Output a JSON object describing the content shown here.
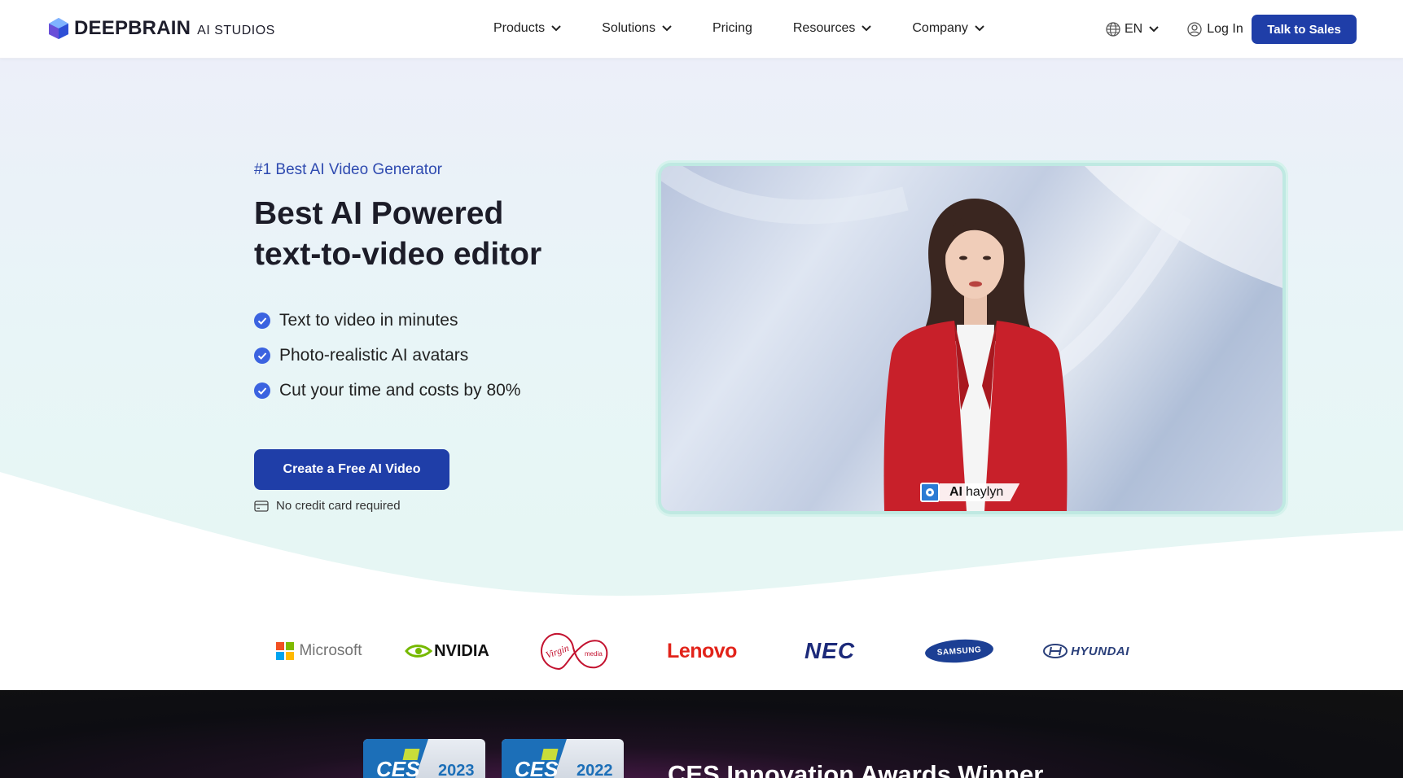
{
  "header": {
    "logo": {
      "brand": "DEEPBRAIN",
      "product": "AI STUDIOS",
      "icon": "deepbrain-cube-logo"
    },
    "nav": [
      {
        "label": "Products",
        "has_dropdown": true
      },
      {
        "label": "Solutions",
        "has_dropdown": true
      },
      {
        "label": "Pricing",
        "has_dropdown": false
      },
      {
        "label": "Resources",
        "has_dropdown": true
      },
      {
        "label": "Company",
        "has_dropdown": true
      }
    ],
    "language": {
      "label": "EN",
      "icon": "globe-icon"
    },
    "login": {
      "label": "Log In",
      "icon": "user-circle-icon"
    },
    "sales_button": "Talk to Sales"
  },
  "hero": {
    "tagline": "#1 Best AI Video Generator",
    "title_line1": "Best AI Powered",
    "title_line2": "text-to-video editor",
    "features": [
      "Text to video in minutes",
      "Photo-realistic AI avatars",
      "Cut your time and costs by 80%"
    ],
    "cta_label": "Create a Free AI Video",
    "no_card_note": "No credit card required",
    "video": {
      "avatar_prefix": "AI",
      "avatar_name": "haylyn"
    }
  },
  "client_logos": [
    "Microsoft",
    "NVIDIA",
    "Virgin media",
    "Lenovo",
    "NEC",
    "SAMSUNG",
    "HYUNDAI"
  ],
  "awards": {
    "badges": [
      {
        "label": "CES",
        "year": "2023"
      },
      {
        "label": "CES",
        "year": "2022"
      }
    ],
    "heading": "CES Innovation Awards Winner"
  },
  "colors": {
    "primary": "#1f3ea8",
    "tagline": "#2f4bb0",
    "check": "#3b63e0",
    "video_border": "#bfe9e2"
  }
}
